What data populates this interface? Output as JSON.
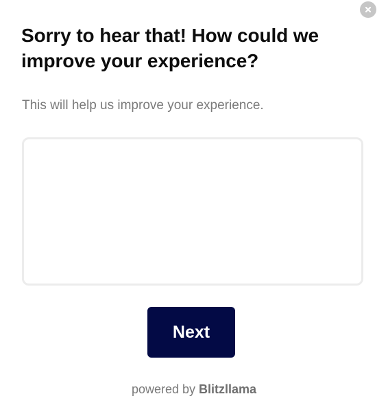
{
  "survey": {
    "close_icon": "close-x-icon",
    "question": "Sorry to hear that! How could we improve your experience?",
    "subtitle": "This will help us improve your experience.",
    "answer": {
      "value": "",
      "placeholder": ""
    },
    "next_label": "Next",
    "footer": {
      "prefix": "powered by",
      "brand": "Blitzllama"
    }
  },
  "colors": {
    "button_background": "#030a45",
    "button_text": "#ffffff",
    "question_text": "#0d0d0d",
    "muted_text": "#7a7a7a",
    "field_border": "#ececec",
    "close_background": "#c6c6c6"
  }
}
